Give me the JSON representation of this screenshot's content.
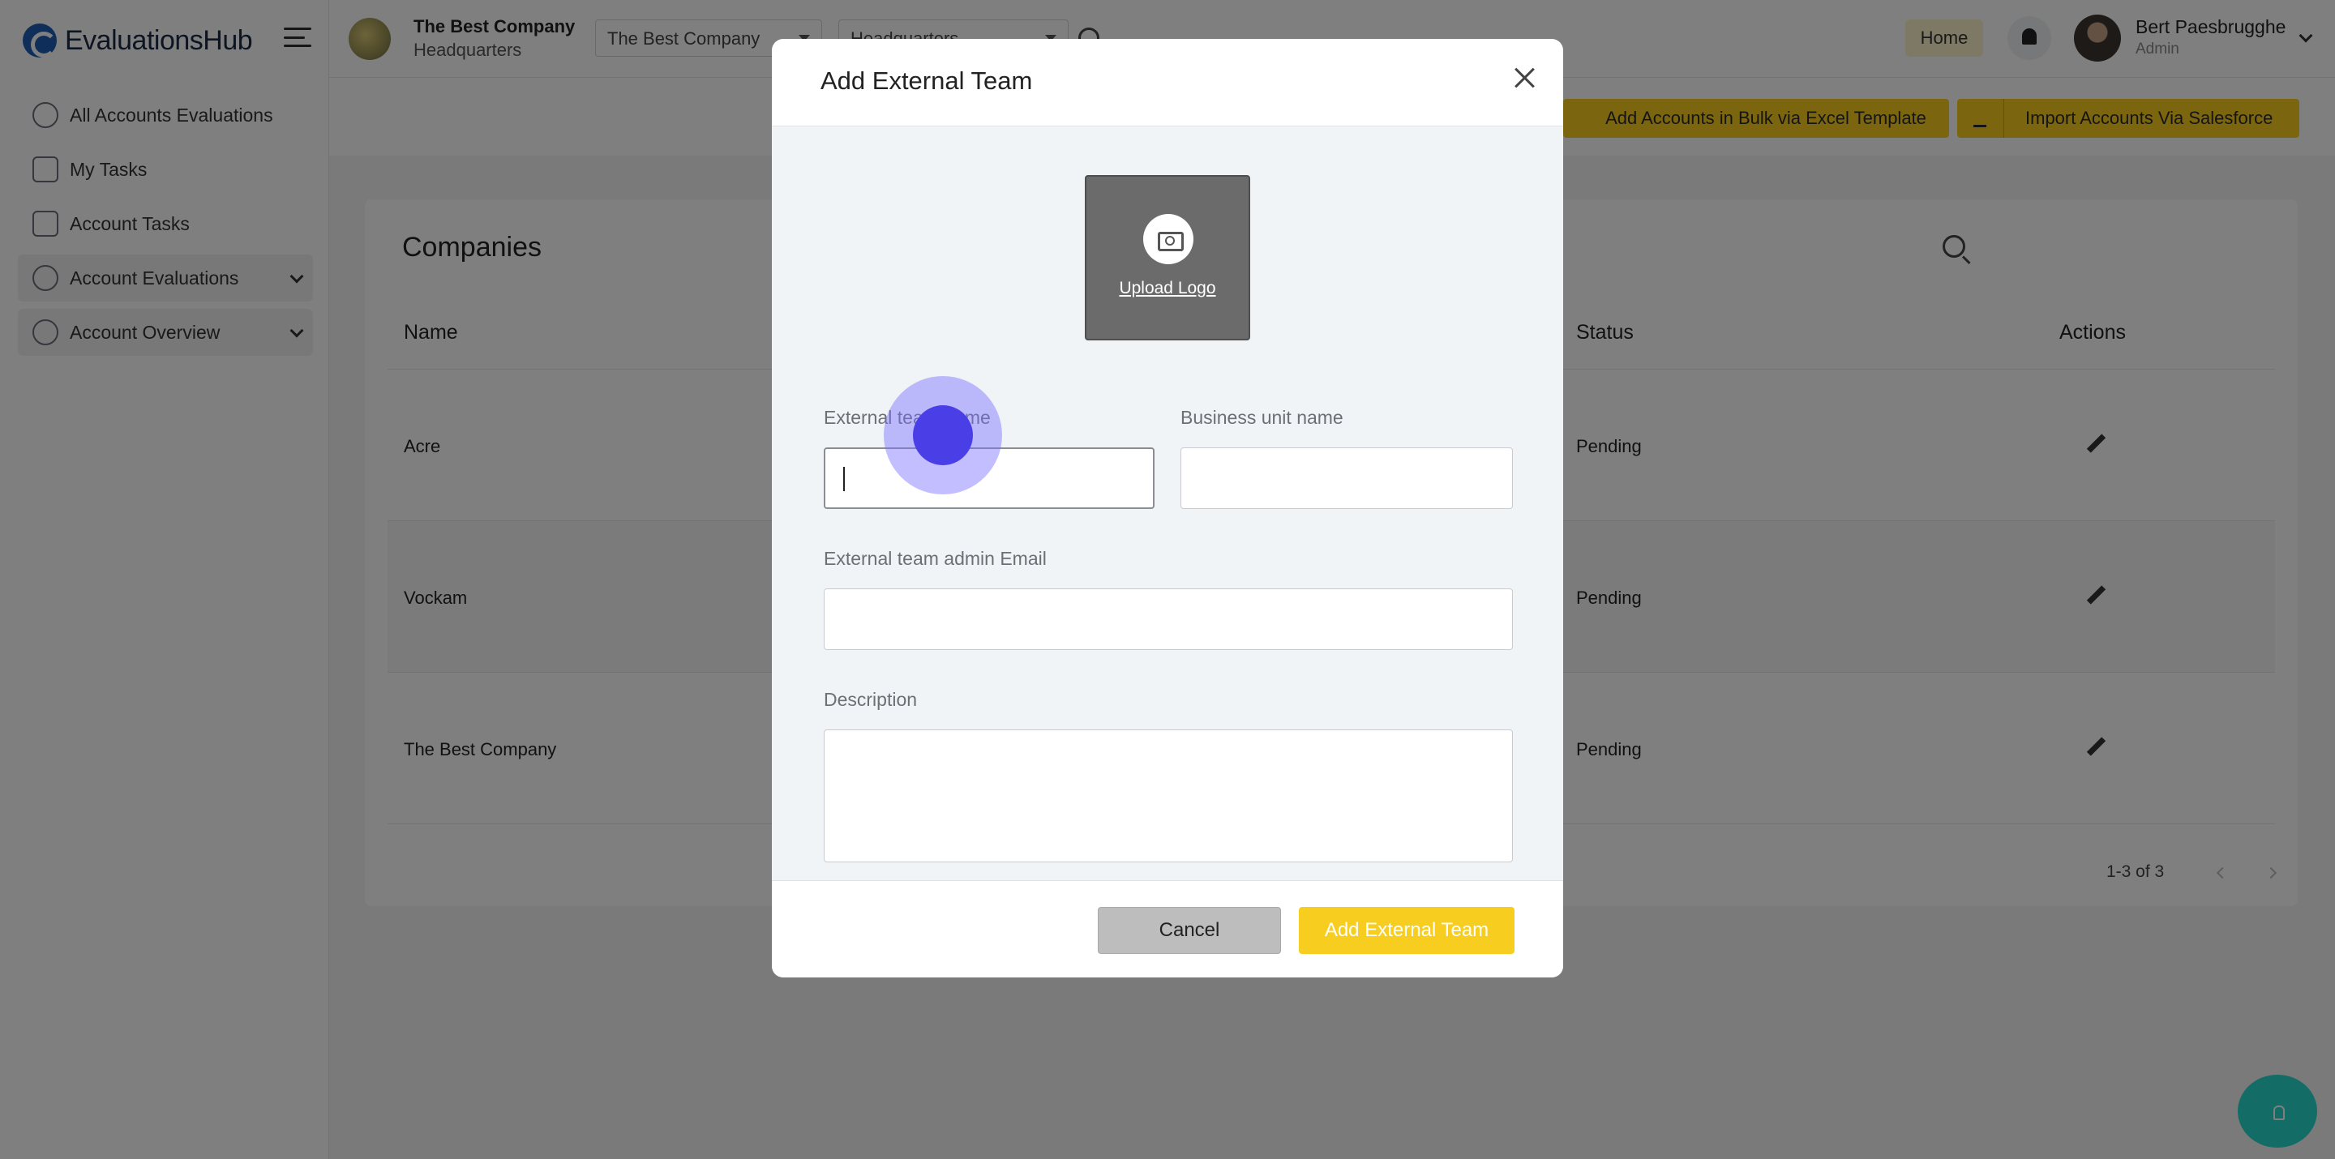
{
  "app": {
    "logo_text": "EvaluationsHub"
  },
  "sidebar": {
    "items": [
      {
        "label": "All Accounts Evaluations",
        "icon": "evaluations-icon"
      },
      {
        "label": "My Tasks",
        "icon": "home-icon"
      },
      {
        "label": "Account Tasks",
        "icon": "checklist-icon"
      },
      {
        "label": "Account Evaluations",
        "icon": "search-gear-icon",
        "expandable": true
      },
      {
        "label": "Account Overview",
        "icon": "search-gear-icon",
        "expandable": true
      }
    ]
  },
  "header": {
    "company_name": "The Best Company",
    "company_sub": "Headquarters",
    "company_select": "The Best Company",
    "location_select": "Headquarters",
    "home_label": "Home",
    "user_name": "Bert Paesbrugghe",
    "user_role": "Admin"
  },
  "toolbar": {
    "bulk_label": "Add Accounts in Bulk via Excel Template",
    "salesforce_label": "Import Accounts Via Salesforce"
  },
  "companies": {
    "title": "Companies",
    "columns": {
      "name": "Name",
      "status": "Status",
      "actions": "Actions"
    },
    "rows": [
      {
        "name": "Acre",
        "status": "Pending"
      },
      {
        "name": "Vockam",
        "status": "Pending"
      },
      {
        "name": "The Best Company",
        "status": "Pending"
      }
    ],
    "pagination": "1-3 of 3"
  },
  "modal": {
    "title": "Add External Team",
    "upload_label": "Upload Logo",
    "fields": {
      "team_name_label": "External team name",
      "team_name_value": "",
      "business_unit_label": "Business unit name",
      "business_unit_value": "",
      "admin_email_label": "External team admin Email",
      "admin_email_value": "",
      "description_label": "Description",
      "description_value": ""
    },
    "cancel_label": "Cancel",
    "submit_label": "Add External Team"
  },
  "colors": {
    "accent_yellow": "#f7cd1f",
    "overlay": "rgba(0,0,0,0.5)",
    "fab": "#26d9cb",
    "click_indicator": "#4a3fe6"
  }
}
